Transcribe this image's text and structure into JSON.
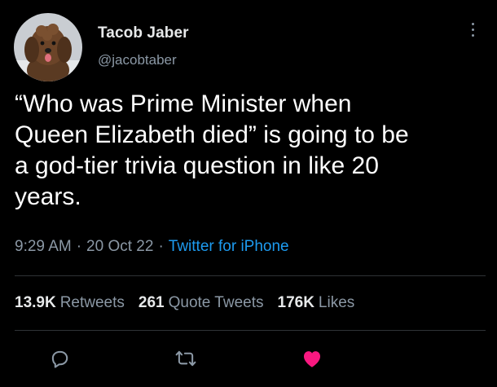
{
  "author": {
    "name": "Tacob Jaber",
    "handle": "@jacobtaber"
  },
  "tweet": {
    "text": "“Who was Prime Minister when\nQueen Elizabeth died” is going to be\na god-tier trivia question in like 20\nyears.",
    "time": "9:29 AM",
    "separator": "·",
    "date": "20 Oct 22",
    "source": "Twitter for iPhone"
  },
  "stats": {
    "retweets_count": "13.9K",
    "retweets_label": "Retweets",
    "quotes_count": "261",
    "quotes_label": "Quote Tweets",
    "likes_count": "176K",
    "likes_label": "Likes"
  },
  "actions": {
    "reply_icon": "reply-icon",
    "retweet_icon": "retweet-icon",
    "like_icon": "heart-icon",
    "liked": true
  },
  "colors": {
    "background": "#000000",
    "text": "#e7e9ea",
    "muted": "#8b98a5",
    "link": "#1d9bf0",
    "like": "#f91880"
  }
}
